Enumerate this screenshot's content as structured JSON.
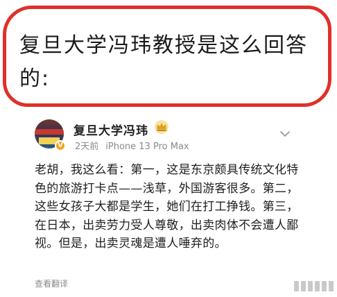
{
  "headline": {
    "text": "复旦大学冯玮教授是这么回答的:"
  },
  "post": {
    "username": "复旦大学冯玮",
    "time": "2天前",
    "device": "iPhone 13 Pro Max",
    "content": "老胡，我这么看：第一，这是东京颇具传统文化特色的旅游打卡点——浅草，外国游客很多。第二，这些女孩子大都是学生，她们在打工挣钱。第三，在日本，出卖劳力受人尊敬，出卖肉体不会遭人鄙视。但是，出卖灵魂是遭人唾弃的。",
    "translate_label": "查看翻译"
  },
  "colors": {
    "outline": "#e0302a",
    "meta_gray": "#8a8a8a",
    "badge": "#f5a623"
  },
  "icons": {
    "verified": "verified-v-icon",
    "crown": "crown-icon",
    "more": "chevron-down-icon"
  }
}
